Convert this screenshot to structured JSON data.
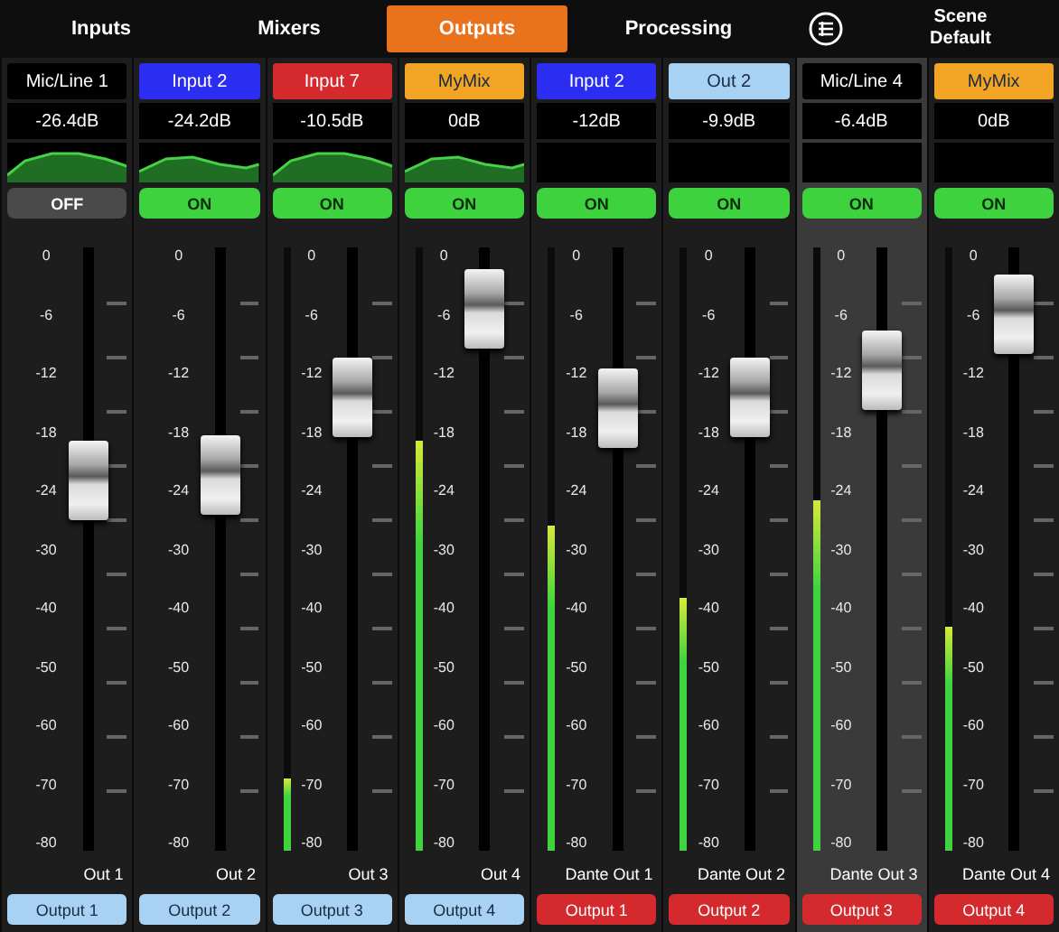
{
  "tabs": [
    {
      "label": "Inputs",
      "selected": false
    },
    {
      "label": "Mixers",
      "selected": false
    },
    {
      "label": "Outputs",
      "selected": true
    },
    {
      "label": "Processing",
      "selected": false
    }
  ],
  "scene": {
    "label": "Scene",
    "value": "Default"
  },
  "strips": [
    {
      "source": "Mic/Line 1",
      "color": "#000000",
      "gain": "-26.4dB",
      "eq": true,
      "on": false,
      "switch": "OFF",
      "selected": false,
      "scale": [
        "0",
        "-6",
        "-12",
        "-18",
        "-24",
        "-30",
        "-40",
        "-50",
        "-60",
        "-70",
        "-80"
      ],
      "fader": {
        "level": 0.63
      },
      "name": "Out 1",
      "output": {
        "label": "Output 1",
        "color": "#a8d2f4"
      }
    },
    {
      "source": "Input 2",
      "color": "#2b2ef0",
      "gain": "-24.2dB",
      "eq": true,
      "on": true,
      "switch": "ON",
      "selected": false,
      "scale": [
        "0",
        "-6",
        "-12",
        "-18",
        "-24",
        "-30",
        "-40",
        "-50",
        "-60",
        "-70",
        "-80"
      ],
      "fader": {
        "level": 0.64
      },
      "name": "Out 2",
      "output": {
        "label": "Output 2",
        "color": "#a8d2f4"
      }
    },
    {
      "source": "Input 7",
      "color": "#d42a2e",
      "gain": "-10.5dB",
      "eq": true,
      "on": true,
      "switch": "ON",
      "selected": false,
      "scale": [
        "0",
        "-6",
        "-12",
        "-18",
        "-24",
        "-30",
        "-40",
        "-50",
        "-60",
        "-70",
        "-80"
      ],
      "fader": {
        "level": 0.79
      },
      "meter": {
        "level": 0.12
      },
      "name": "Out 3",
      "output": {
        "label": "Output 3",
        "color": "#a8d2f4"
      }
    },
    {
      "source": "MyMix",
      "color": "#f2a424",
      "gain": "0dB",
      "eq": true,
      "on": true,
      "switch": "ON",
      "selected": false,
      "scale": [
        "0",
        "-6",
        "-12",
        "-18",
        "-24",
        "-30",
        "-40",
        "-50",
        "-60",
        "-70",
        "-80"
      ],
      "fader": {
        "level": 0.96
      },
      "meter": {
        "level": 0.68
      },
      "name": "Out 4",
      "output": {
        "label": "Output 4",
        "color": "#a8d2f4"
      }
    },
    {
      "source": "Input 2",
      "color": "#2b2ef0",
      "gain": "-12dB",
      "eq": false,
      "on": true,
      "switch": "ON",
      "selected": false,
      "scale": [
        "0",
        "-6",
        "-12",
        "-18",
        "-24",
        "-30",
        "-40",
        "-50",
        "-60",
        "-70",
        "-80"
      ],
      "fader": {
        "level": 0.77
      },
      "meter": {
        "level": 0.54
      },
      "name": "Dante Out 1",
      "output": {
        "label": "Output 1",
        "color": "#d42a2e"
      }
    },
    {
      "source": "Out 2",
      "color": "#a8d2f4",
      "gain": "-9.9dB",
      "eq": false,
      "on": true,
      "switch": "ON",
      "selected": false,
      "scale": [
        "0",
        "-6",
        "-12",
        "-18",
        "-24",
        "-30",
        "-40",
        "-50",
        "-60",
        "-70",
        "-80"
      ],
      "fader": {
        "level": 0.79
      },
      "meter": {
        "level": 0.42
      },
      "name": "Dante Out 2",
      "output": {
        "label": "Output 2",
        "color": "#d42a2e"
      }
    },
    {
      "source": "Mic/Line 4",
      "color": "#000000",
      "gain": "-6.4dB",
      "eq": false,
      "on": true,
      "switch": "ON",
      "selected": true,
      "scale": [
        "0",
        "-6",
        "-12",
        "-18",
        "-24",
        "-30",
        "-40",
        "-50",
        "-60",
        "-70",
        "-80"
      ],
      "fader": {
        "level": 0.84
      },
      "meter": {
        "level": 0.58
      },
      "name": "Dante Out 3",
      "output": {
        "label": "Output 3",
        "color": "#d42a2e"
      }
    },
    {
      "source": "MyMix",
      "color": "#f2a424",
      "gain": "0dB",
      "eq": false,
      "on": true,
      "switch": "ON",
      "selected": false,
      "scale": [
        "0",
        "-6",
        "-12",
        "-18",
        "-24",
        "-30",
        "-40",
        "-50",
        "-60",
        "-70",
        "-80"
      ],
      "fader": {
        "level": 0.95
      },
      "meter": {
        "level": 0.37
      },
      "name": "Dante Out 4",
      "output": {
        "label": "Output 4",
        "color": "#d42a2e"
      }
    }
  ]
}
